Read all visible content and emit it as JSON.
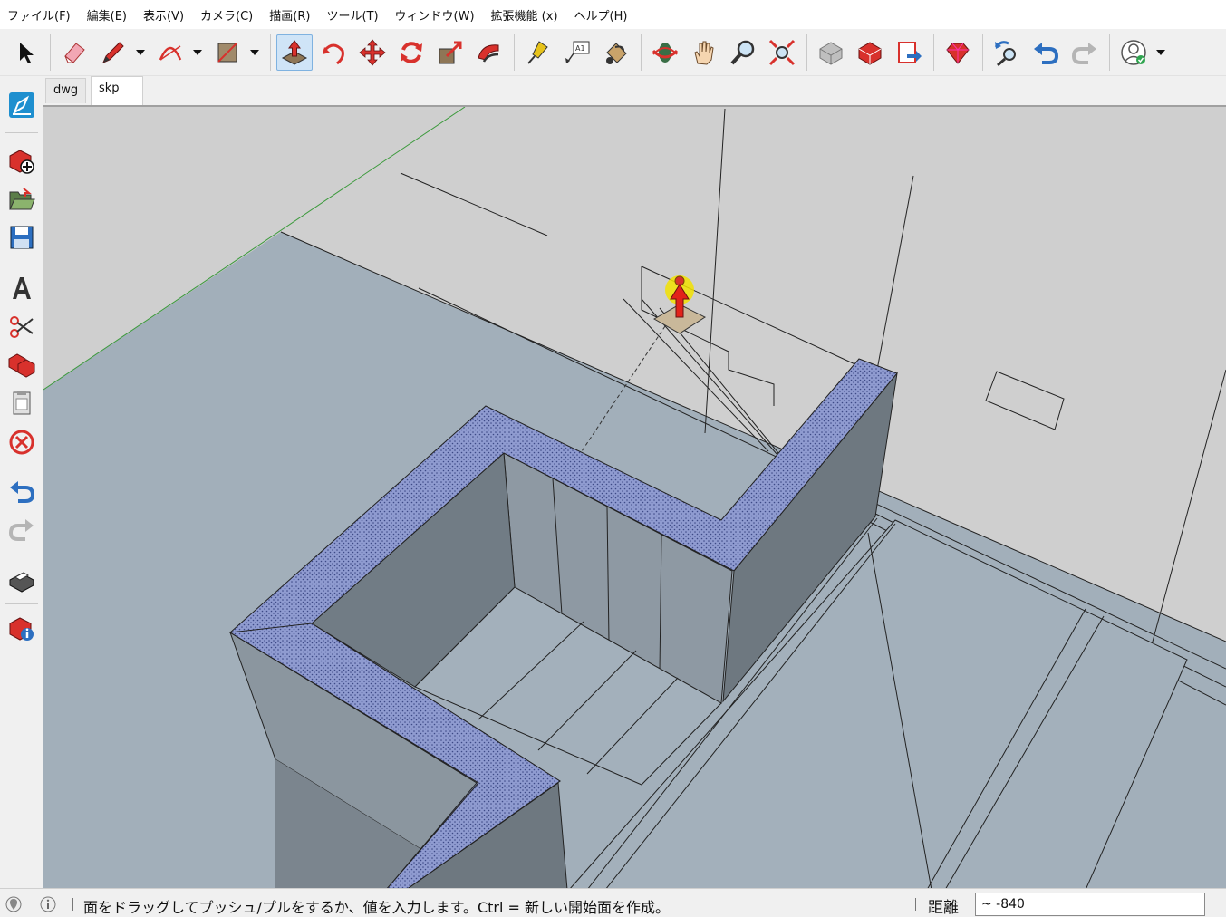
{
  "menu": {
    "items": [
      "ファイル(F)",
      "編集(E)",
      "表示(V)",
      "カメラ(C)",
      "描画(R)",
      "ツール(T)",
      "ウィンドウ(W)",
      "拡張機能 (x)",
      "ヘルプ(H)"
    ]
  },
  "toolbar": {
    "tools": [
      "select-icon",
      "eraser-icon",
      "pencil-icon",
      "arc-icon",
      "rectangle-icon",
      "push-pull-icon",
      "follow-me-icon",
      "move-icon",
      "rotate-icon",
      "scale-icon",
      "offset-icon",
      "tape-measure-icon",
      "text-icon",
      "paint-bucket-icon",
      "orbit-icon",
      "pan-icon",
      "zoom-icon",
      "zoom-extents-icon",
      "warehouse-icon",
      "extension-warehouse-icon",
      "send-to-layout-icon",
      "ruby-console-icon",
      "undo-icon",
      "redo-icon",
      "account-icon"
    ],
    "active_tool": "push-pull-icon"
  },
  "left_toolbar": {
    "tools": [
      "layout-logo-icon",
      "new-icon",
      "open-icon",
      "save-icon",
      "text-style-icon",
      "cut-icon",
      "copy-icon",
      "paste-icon",
      "delete-icon",
      "undo-icon",
      "redo-icon",
      "print-icon",
      "model-info-icon"
    ]
  },
  "tabs": [
    {
      "label": "dwg",
      "active": false
    },
    {
      "label": "skp",
      "active": true
    }
  ],
  "status": {
    "message": "面をドラッグしてプッシュ/プルをするか、値を入力します。Ctrl = 新しい開始面を作成。",
    "measure_label": "距離",
    "measure_value": "~ -840"
  },
  "colors": {
    "ground": "#a2afba",
    "background": "#cfcfcf",
    "wall_top": "#8d99c8",
    "wall_side": "#7b858e",
    "accent_active": "#cfe4f7"
  }
}
